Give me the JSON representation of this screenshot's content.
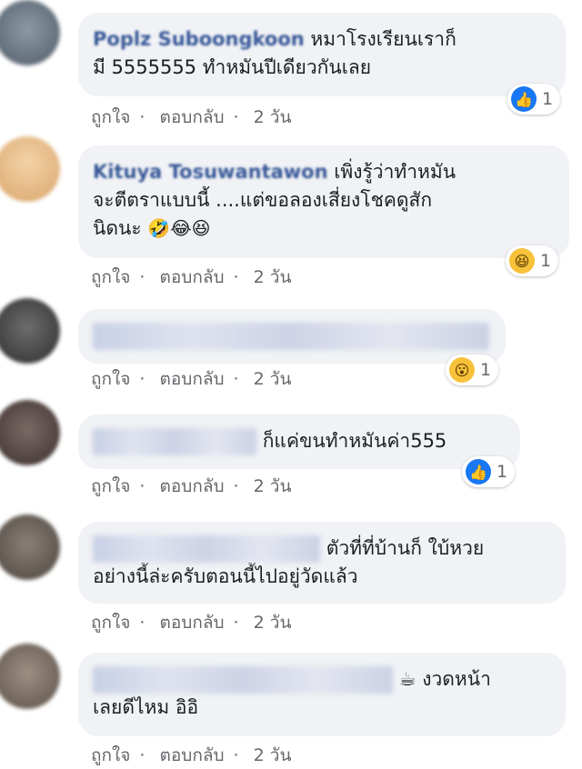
{
  "comments": [
    {
      "author": "Poplz Suboongkoon",
      "text_line1": "หมาโรงเรียนเราก็",
      "text_line2": "มี 5555555 ทำหมันปีเดียวกันเลย",
      "like_label": "ถูกใจ",
      "reply_label": "ตอบกลับ",
      "time": "2 วัน",
      "reaction_icon": "like-icon",
      "reaction_count": "1"
    },
    {
      "author": "Kituya Tosuwantawon",
      "text_line1": "เพิ่งรู้ว่าทำหมัน",
      "text_line2": "จะตีตราแบบนี้ ....แต่ขอลองเสี่ยงโชคดูสัก",
      "text_line3": "นิดนะ",
      "emojis": "🤣😂😆",
      "like_label": "ถูกใจ",
      "reply_label": "ตอบกลับ",
      "time": "2 วัน",
      "reaction_icon": "haha-icon",
      "reaction_count": "1"
    },
    {
      "like_label": "ถูกใจ",
      "reply_label": "ตอบกลับ",
      "time": "2 วัน",
      "reaction_icon": "wow-icon",
      "reaction_count": "1"
    },
    {
      "text_line1": "ก็แค่ขนทำหมันค่า555",
      "like_label": "ถูกใจ",
      "reply_label": "ตอบกลับ",
      "time": "2 วัน",
      "reaction_icon": "like-icon",
      "reaction_count": "1"
    },
    {
      "text_line1": "ตัวที่ที่บ้านก็ ใบ้หวย",
      "text_line2": "อย่างนี้ล่ะครับตอนนี้ไปอยู่วัดแล้ว",
      "like_label": "ถูกใจ",
      "reply_label": "ตอบกลับ",
      "time": "2 วัน"
    },
    {
      "text_line1": "☕ งวดหน้า",
      "text_line2": "เลยดีไหม อิอิ",
      "like_label": "ถูกใจ",
      "reply_label": "ตอบกลับ",
      "time": "2 วัน"
    }
  ],
  "dot": "·",
  "colors": {
    "bubble": "#f0f2f5",
    "link": "#385898",
    "meta": "#65676b",
    "like_blue": "#1877f2"
  }
}
